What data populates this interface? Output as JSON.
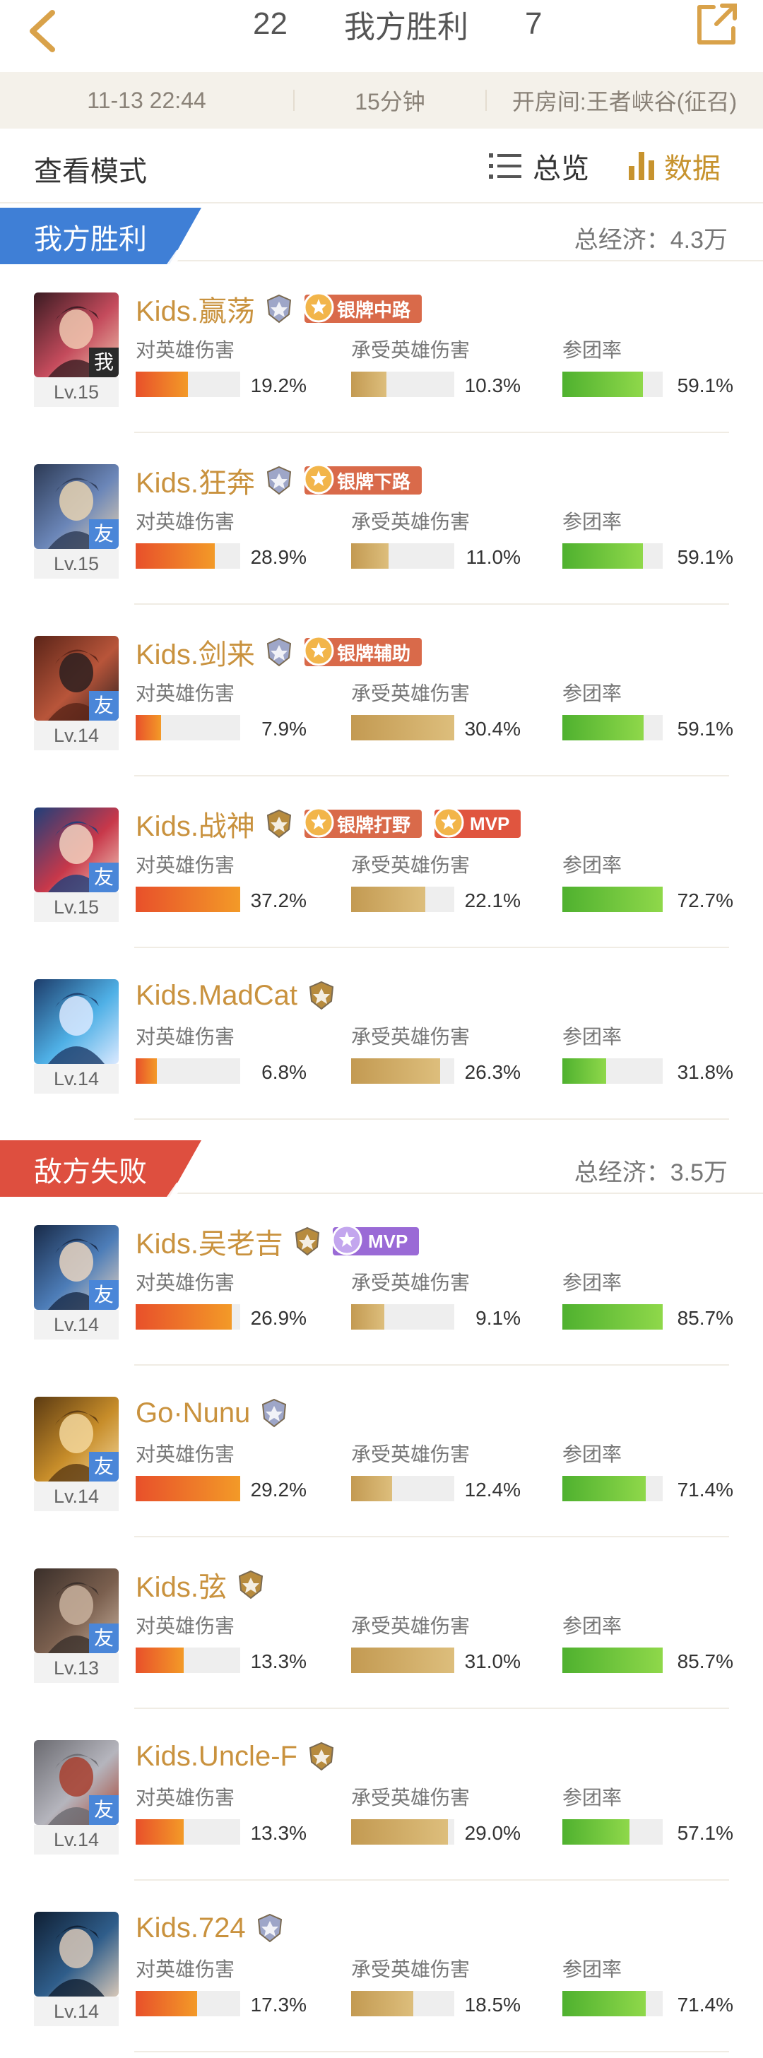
{
  "header": {
    "our_score": "22",
    "result": "我方胜利",
    "enemy_score": "7"
  },
  "info": {
    "time": "11-13 22:44",
    "duration": "15分钟",
    "room": "开房间:王者峡谷(征召)"
  },
  "mode": {
    "label": "查看模式",
    "overview": "总览",
    "data": "数据"
  },
  "stat_labels": {
    "damage_dealt": "对英雄伤害",
    "damage_taken": "承受英雄伤害",
    "participation": "参团率"
  },
  "colors": {
    "accent_gold": "#c7932e",
    "ally_blue": "#3f7fd6",
    "enemy_red": "#de4f3f"
  },
  "ally": {
    "title": "我方胜利",
    "economy": "总经济：4.3万",
    "players": [
      {
        "name": "Kids.赢荡",
        "tag": "我",
        "level": "Lv.15",
        "rank_icon": "silver-rank-shield-icon",
        "badges": [
          {
            "text": "银牌中路",
            "style": "red"
          }
        ],
        "dealt": "19.2%",
        "dealt_fill": 0.5,
        "taken": "10.3%",
        "taken_fill": 0.34,
        "part": "59.1%",
        "part_fill": 0.8
      },
      {
        "name": "Kids.狂奔",
        "tag": "友",
        "level": "Lv.15",
        "rank_icon": "silver-rank-shield-icon",
        "badges": [
          {
            "text": "银牌下路",
            "style": "red"
          }
        ],
        "dealt": "28.9%",
        "dealt_fill": 0.76,
        "taken": "11.0%",
        "taken_fill": 0.36,
        "part": "59.1%",
        "part_fill": 0.8
      },
      {
        "name": "Kids.剑来",
        "tag": "友",
        "level": "Lv.14",
        "rank_icon": "silver-rank-wings-icon",
        "badges": [
          {
            "text": "银牌辅助",
            "style": "red"
          }
        ],
        "dealt": "7.9%",
        "dealt_fill": 0.24,
        "taken": "30.4%",
        "taken_fill": 1.0,
        "part": "59.1%",
        "part_fill": 0.81
      },
      {
        "name": "Kids.战神",
        "tag": "友",
        "level": "Lv.15",
        "rank_icon": "gold-rank-star-icon",
        "badges": [
          {
            "text": "银牌打野",
            "style": "red"
          },
          {
            "text": "MVP",
            "style": "mvp-red"
          }
        ],
        "dealt": "37.2%",
        "dealt_fill": 1.0,
        "taken": "22.1%",
        "taken_fill": 0.72,
        "part": "72.7%",
        "part_fill": 1.0
      },
      {
        "name": "Kids.MadCat",
        "tag": "",
        "level": "Lv.14",
        "rank_icon": "gold-rank-iv-icon",
        "badges": [],
        "dealt": "6.8%",
        "dealt_fill": 0.2,
        "taken": "26.3%",
        "taken_fill": 0.86,
        "part": "31.8%",
        "part_fill": 0.44
      }
    ]
  },
  "enemy": {
    "title": "敌方失败",
    "economy": "总经济：3.5万",
    "players": [
      {
        "name": "Kids.吴老吉",
        "tag": "友",
        "level": "Lv.14",
        "rank_icon": "gold-rank-iv-icon",
        "badges": [
          {
            "text": "MVP",
            "style": "mvp-purple"
          }
        ],
        "dealt": "26.9%",
        "dealt_fill": 0.92,
        "taken": "9.1%",
        "taken_fill": 0.32,
        "part": "85.7%",
        "part_fill": 1.0
      },
      {
        "name": "Go·Nunu",
        "tag": "友",
        "level": "Lv.14",
        "rank_icon": "silver-rank-iv-icon",
        "badges": [],
        "dealt": "29.2%",
        "dealt_fill": 1.0,
        "taken": "12.4%",
        "taken_fill": 0.4,
        "part": "71.4%",
        "part_fill": 0.83
      },
      {
        "name": "Kids.弦",
        "tag": "友",
        "level": "Lv.13",
        "rank_icon": "gold-rank-star-icon",
        "badges": [],
        "dealt": "13.3%",
        "dealt_fill": 0.46,
        "taken": "31.0%",
        "taken_fill": 1.0,
        "part": "85.7%",
        "part_fill": 1.0
      },
      {
        "name": "Kids.Uncle-F",
        "tag": "友",
        "level": "Lv.14",
        "rank_icon": "gold-rank-star-icon",
        "badges": [],
        "dealt": "13.3%",
        "dealt_fill": 0.46,
        "taken": "29.0%",
        "taken_fill": 0.94,
        "part": "57.1%",
        "part_fill": 0.67
      },
      {
        "name": "Kids.724",
        "tag": "",
        "level": "Lv.14",
        "rank_icon": "silver-rank-iii-icon",
        "badges": [],
        "dealt": "17.3%",
        "dealt_fill": 0.59,
        "taken": "18.5%",
        "taken_fill": 0.6,
        "part": "71.4%",
        "part_fill": 0.83
      }
    ]
  }
}
